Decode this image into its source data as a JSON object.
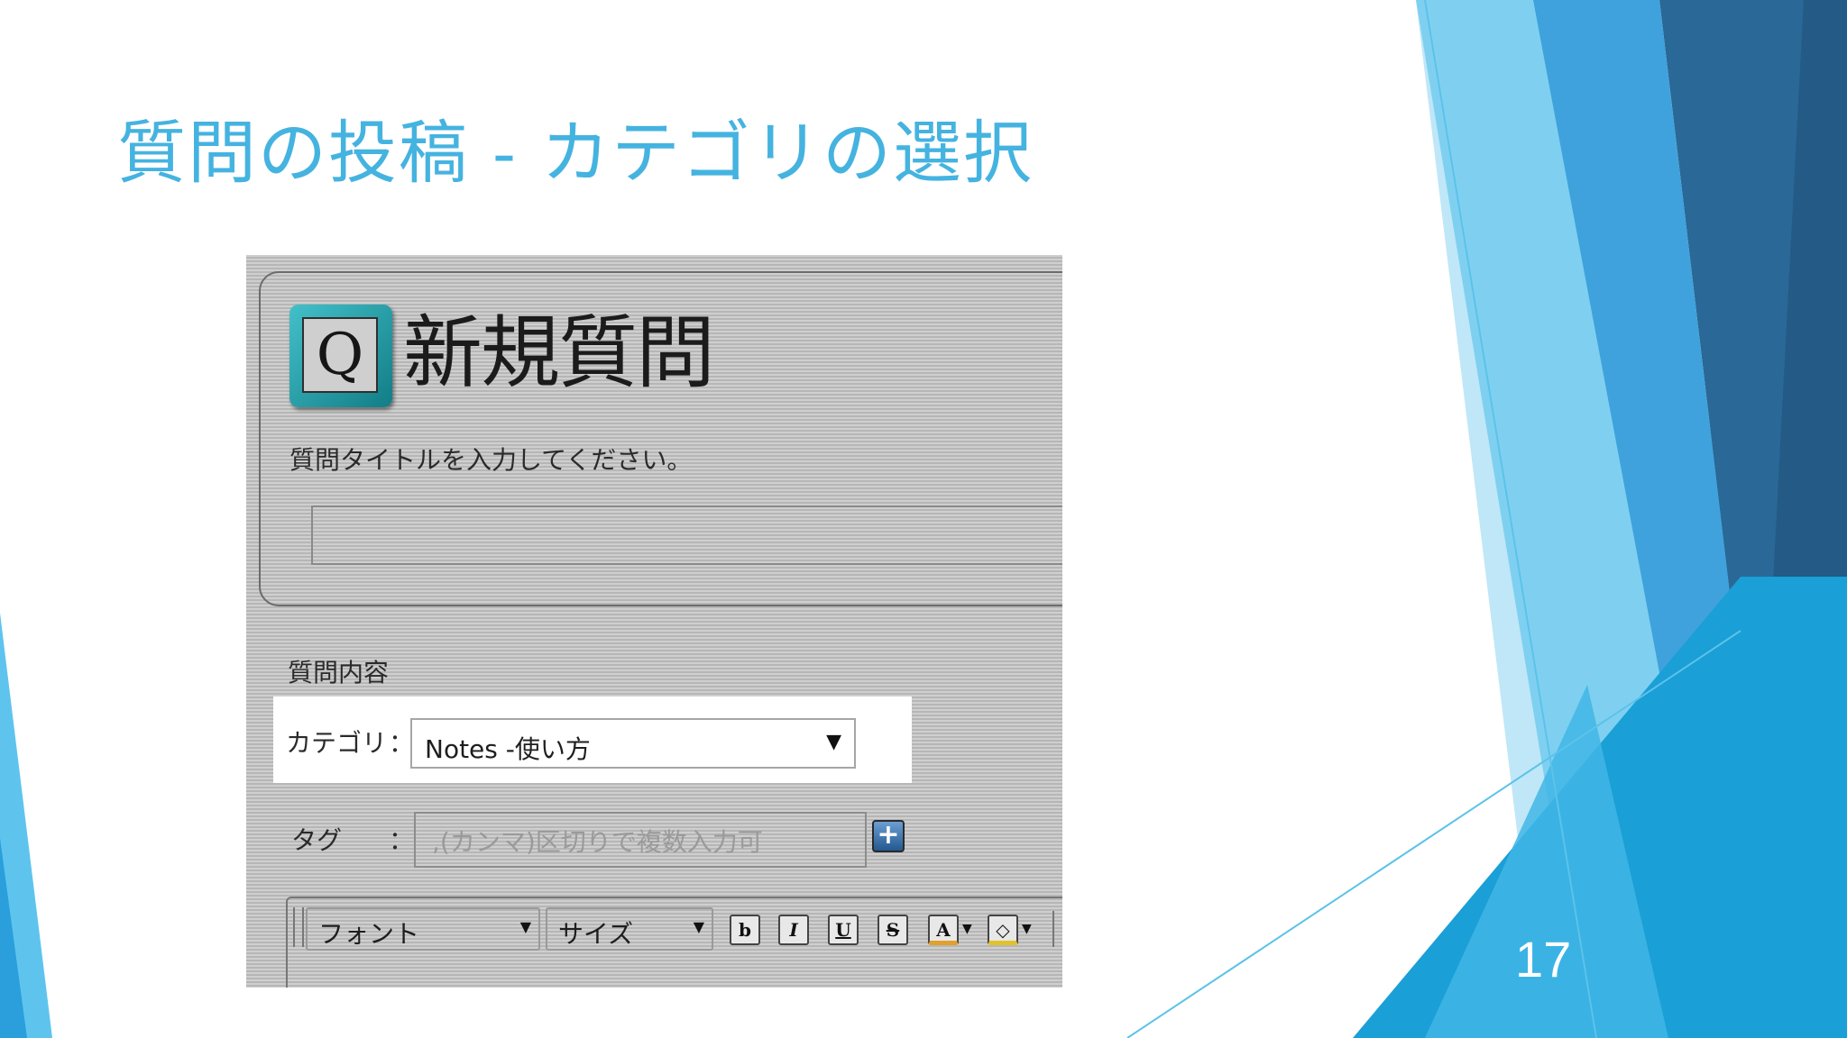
{
  "slide": {
    "title": "質問の投稿 - カテゴリの選択",
    "page_number": "17",
    "colors": {
      "title": "#45b3e0",
      "accent_dark": "#2a6897",
      "accent_mid": "#1aa7e0",
      "accent_light": "#7fd0f0"
    }
  },
  "dialog": {
    "icon_letter": "Q",
    "title": "新規質問",
    "title_prompt": "質問タイトルを入力してください。",
    "title_input_value": "",
    "content_section_label": "質問内容",
    "category": {
      "label": "カテゴリ",
      "separator": "：",
      "selected": "Notes -使い方"
    },
    "tag": {
      "label": "タグ",
      "separator": "：",
      "placeholder": ",(カンマ)区切りで複数入力可"
    },
    "toolbar": {
      "font_label": "フォント",
      "size_label": "サイズ",
      "buttons": [
        {
          "icon": "bold-icon",
          "glyph": "b"
        },
        {
          "icon": "italic-icon",
          "glyph": "I"
        },
        {
          "icon": "underline-icon",
          "glyph": "U"
        },
        {
          "icon": "strikethrough-icon",
          "glyph": "S"
        },
        {
          "icon": "text-color-icon",
          "glyph": "A"
        },
        {
          "icon": "highlight-icon",
          "glyph": "◇"
        }
      ]
    }
  }
}
